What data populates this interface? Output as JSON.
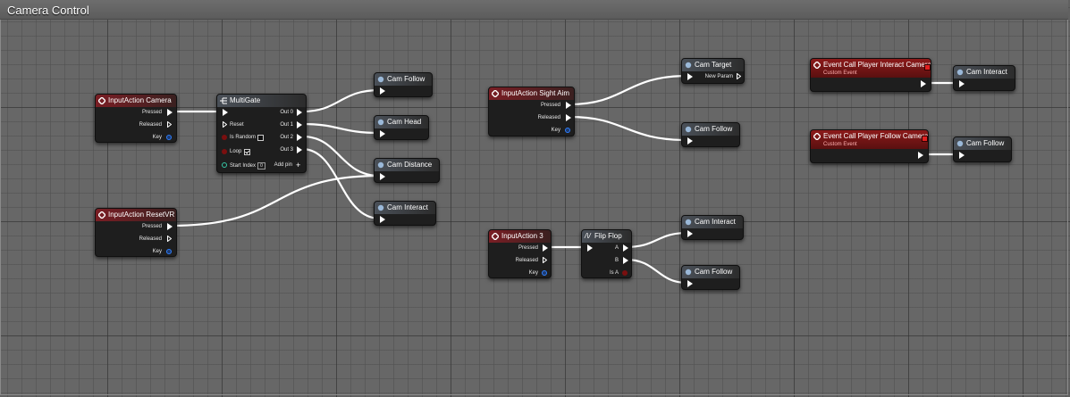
{
  "comment_title": "Camera Control",
  "nodes": {
    "ia_camera": {
      "title": "InputAction Camera",
      "pressed": "Pressed",
      "released": "Released",
      "key": "Key"
    },
    "multigate": {
      "title": "MultiGate",
      "reset": "Reset",
      "is_random": "Is Random",
      "loop": "Loop",
      "start_index": "Start Index",
      "start_index_value": "0",
      "out0": "Out 0",
      "out1": "Out 1",
      "out2": "Out 2",
      "out3": "Out 3",
      "add_pin": "Add pin"
    },
    "ia_resetvr": {
      "title": "InputAction ResetVR",
      "pressed": "Pressed",
      "released": "Released",
      "key": "Key"
    },
    "cam_follow_1": {
      "title": "Cam Follow"
    },
    "cam_head": {
      "title": "Cam Head"
    },
    "cam_distance": {
      "title": "Cam Distance"
    },
    "cam_interact_1": {
      "title": "Cam Interact"
    },
    "ia_sight_aim": {
      "title": "InputAction Sight Aim",
      "pressed": "Pressed",
      "released": "Released",
      "key": "Key"
    },
    "cam_target": {
      "title": "Cam Target",
      "new_param": "New Param"
    },
    "cam_follow_2": {
      "title": "Cam Follow"
    },
    "ia_3": {
      "title": "InputAction 3",
      "pressed": "Pressed",
      "released": "Released",
      "key": "Key"
    },
    "flipflop": {
      "title": "Flip Flop",
      "a": "A",
      "b": "B",
      "is_a": "Is A"
    },
    "cam_interact_2": {
      "title": "Cam Interact"
    },
    "cam_follow_3": {
      "title": "Cam Follow"
    },
    "ev_interact": {
      "title": "Event Call Player Interact Camera",
      "subtitle": "Custom Event"
    },
    "cam_interact_3": {
      "title": "Cam Interact"
    },
    "ev_follow": {
      "title": "Event Call Player Follow Camera",
      "subtitle": "Custom Event"
    },
    "cam_follow_4": {
      "title": "Cam Follow"
    }
  },
  "colors": {
    "input_header": "#7a1e24",
    "function_header": "#4a5058",
    "event_header": "#8c1a1a",
    "wire": "#ffffff",
    "grid": "#616161"
  },
  "icons": {
    "input_action": "input-action-icon",
    "function": "function-icon",
    "multigate": "multigate-icon",
    "flipflop": "flipflop-icon",
    "event": "event-icon"
  }
}
